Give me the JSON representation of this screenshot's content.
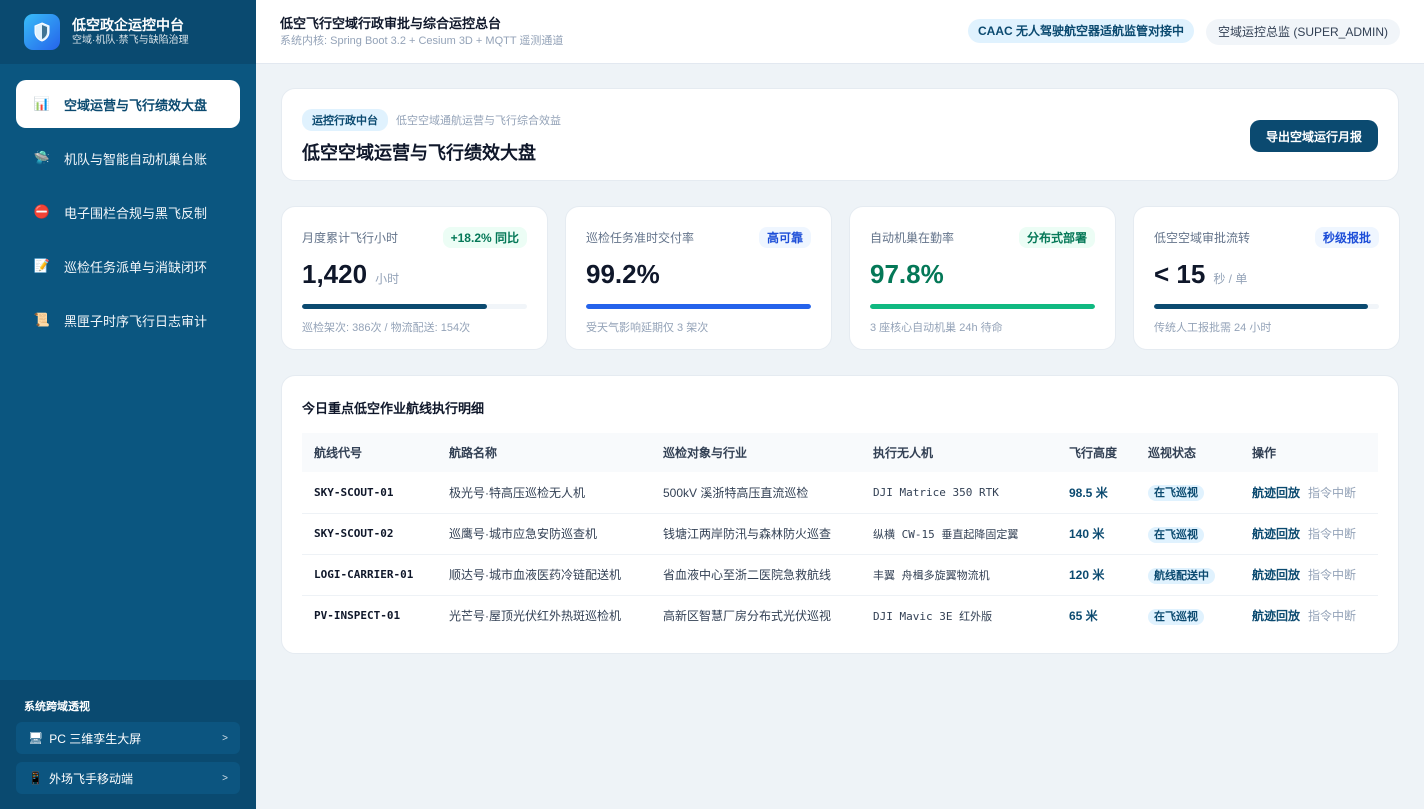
{
  "brand": {
    "title": "低空政企运控中台",
    "subtitle": "空域·机队·禁飞与缺陷治理"
  },
  "sidebar": {
    "items": [
      {
        "icon": "📊",
        "label": "空域运营与飞行绩效大盘",
        "active": true
      },
      {
        "icon": "🛸",
        "label": "机队与智能自动机巢台账"
      },
      {
        "icon": "⛔",
        "label": "电子围栏合规与黑飞反制"
      },
      {
        "icon": "📝",
        "label": "巡检任务派单与消缺闭环"
      },
      {
        "icon": "📜",
        "label": "黑匣子时序飞行日志审计"
      }
    ],
    "bottom_title": "系统跨域透视",
    "bottom_links": [
      {
        "icon": "🖥",
        "label": "PC 三维孪生大屏",
        "arrow": ">"
      },
      {
        "icon": "📱",
        "label": "外场飞手移动端",
        "arrow": ">"
      }
    ]
  },
  "header": {
    "title": "低空飞行空域行政审批与综合运控总台",
    "subtitle": "系统内核: Spring Boot 3.2 + Cesium 3D + MQTT 遥测通道",
    "caac_pill": "CAAC 无人驾驶航空器适航监管对接中",
    "user_pill": "空域运控总监 (SUPER_ADMIN)"
  },
  "hero": {
    "tag": "运控行政中台",
    "tag_sub": "低空空域通航运营与飞行综合效益",
    "title": "低空空域运营与飞行绩效大盘",
    "export_button": "导出空域运行月报"
  },
  "kpis": [
    {
      "label": "月度累计飞行小时",
      "badge": "+18.2% 同比",
      "value": "1,420",
      "unit": "小时",
      "progress": 0.82,
      "foot": "巡检架次: 386次 / 物流配送: 154次",
      "value_color": "#0f172a",
      "bar_color": "#0b4a70",
      "badge_bg": "#ecfdf5",
      "badge_color": "#047857"
    },
    {
      "label": "巡检任务准时交付率",
      "badge": "高可靠",
      "value": "99.2%",
      "unit": "",
      "progress": 1.0,
      "foot": "受天气影响延期仅 3 架次",
      "value_color": "#0f172a",
      "bar_color": "#2563eb",
      "badge_bg": "#eff6ff",
      "badge_color": "#1d4ed8"
    },
    {
      "label": "自动机巢在勤率",
      "badge": "分布式部署",
      "value": "97.8%",
      "unit": "",
      "progress": 1.0,
      "foot": "3 座核心自动机巢 24h 待命",
      "value_color": "#047857",
      "bar_color": "#10b981",
      "badge_bg": "#ecfdf5",
      "badge_color": "#047857"
    },
    {
      "label": "低空空域审批流转",
      "badge": "秒级报批",
      "value": "< 15",
      "unit": "秒 / 单",
      "progress": 0.95,
      "foot": "传统人工报批需 24 小时",
      "value_color": "#0f172a",
      "bar_color": "#0b4a70",
      "badge_bg": "#eff6ff",
      "badge_color": "#1d4ed8"
    }
  ],
  "table": {
    "title": "今日重点低空作业航线执行明细",
    "columns": [
      "航线代号",
      "航路名称",
      "巡检对象与行业",
      "执行无人机",
      "飞行高度",
      "巡视状态",
      "操作"
    ],
    "rows": [
      {
        "code": "SKY-SCOUT-01",
        "route": "极光号·特高压巡检无人机",
        "target": "500kV 溪浙特高压直流巡检",
        "drone": "DJI Matrice 350 RTK",
        "altitude": "98.5 米",
        "status": "在飞巡视",
        "op_main": "航迹回放",
        "op_sub": "指令中断"
      },
      {
        "code": "SKY-SCOUT-02",
        "route": "巡鹰号·城市应急安防巡查机",
        "target": "钱塘江两岸防汛与森林防火巡查",
        "drone": "纵横 CW-15 垂直起降固定翼",
        "altitude": "140 米",
        "status": "在飞巡视",
        "op_main": "航迹回放",
        "op_sub": "指令中断"
      },
      {
        "code": "LOGI-CARRIER-01",
        "route": "顺达号·城市血液医药冷链配送机",
        "target": "省血液中心至浙二医院急救航线",
        "drone": "丰翼 舟楫多旋翼物流机",
        "altitude": "120 米",
        "status": "航线配送中",
        "op_main": "航迹回放",
        "op_sub": "指令中断"
      },
      {
        "code": "PV-INSPECT-01",
        "route": "光芒号·屋顶光伏红外热斑巡检机",
        "target": "高新区智慧厂房分布式光伏巡视",
        "drone": "DJI Mavic 3E 红外版",
        "altitude": "65 米",
        "status": "在飞巡视",
        "op_main": "航迹回放",
        "op_sub": "指令中断"
      }
    ]
  }
}
